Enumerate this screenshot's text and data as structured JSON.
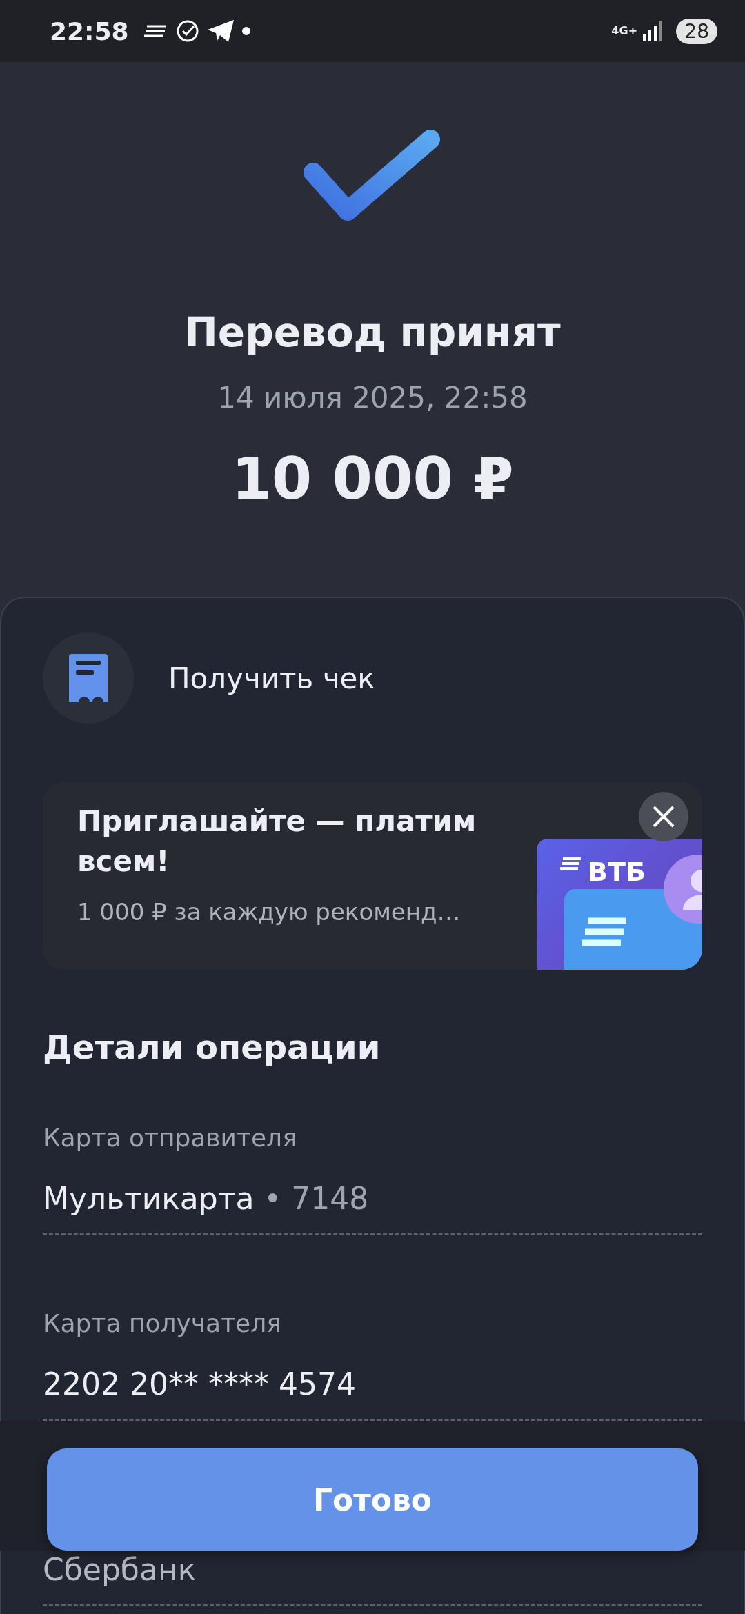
{
  "status_bar": {
    "time": "22:58",
    "network": "4G+",
    "battery": "28"
  },
  "result": {
    "title": "Перевод принят",
    "date": "14 июля 2025, 22:58",
    "amount": "10 000 ₽"
  },
  "receipt": {
    "label": "Получить чек"
  },
  "promo": {
    "title": "Приглашайте — платим всем!",
    "subtitle": "1 000 ₽ за каждую рекоменд…",
    "brand": "ВТБ"
  },
  "details": {
    "title": "Детали операции",
    "items": [
      {
        "label": "Карта отправителя",
        "value": "Мультикарта",
        "suffix": "• 7148"
      },
      {
        "label": "Карта получателя",
        "value": "2202 20** **** 4574"
      },
      {
        "value": "Сбербанк"
      }
    ]
  },
  "footer": {
    "button": "Готово"
  }
}
